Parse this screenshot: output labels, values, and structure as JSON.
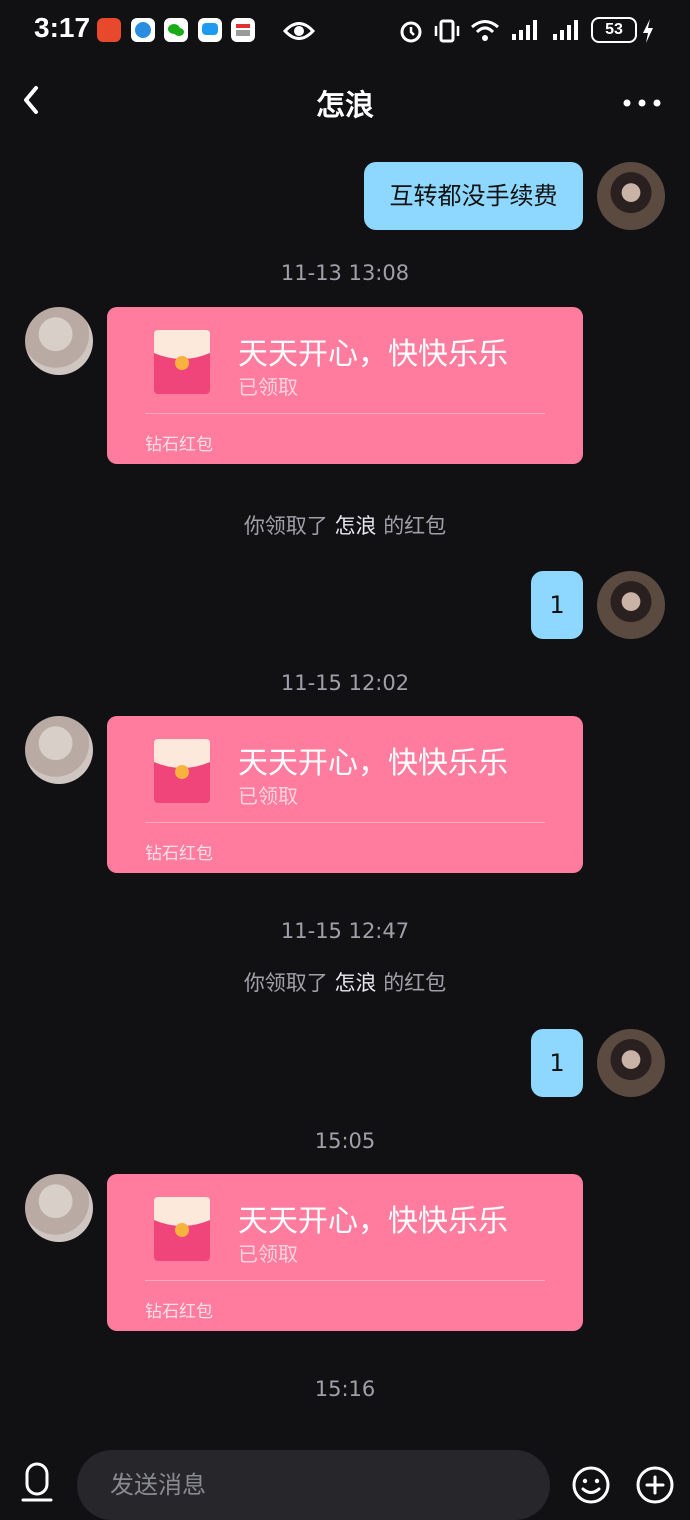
{
  "status_bar": {
    "time": "3:17",
    "battery": "53",
    "icons": [
      "notification-app-icon",
      "browser-app-icon",
      "wechat-icon",
      "message-app-icon",
      "news-app-icon",
      "eye-icon",
      "alarm-icon",
      "vibrate-icon",
      "wifi-icon",
      "signal-icon",
      "signal-icon",
      "battery-icon",
      "charging-icon"
    ]
  },
  "header": {
    "title": "怎浪",
    "back_icon": "chevron-left-icon",
    "more_icon": "more-horizontal-icon"
  },
  "messages": {
    "m1_text": "互转都没手续费",
    "t1": "11-13 13:08",
    "rp1_title": "天天开心，快快乐乐",
    "rp1_status": "已领取",
    "rp1_label": "钻石红包",
    "sys1_prefix": "你领取了",
    "sys1_name": "怎浪",
    "sys1_suffix": "的红包",
    "m2_text": "1",
    "t2": "11-15 12:02",
    "rp2_title": "天天开心，快快乐乐",
    "rp2_status": "已领取",
    "rp2_label": "钻石红包",
    "t3": "11-15 12:47",
    "sys2_prefix": "你领取了",
    "sys2_name": "怎浪",
    "sys2_suffix": "的红包",
    "m3_text": "1",
    "t4": "15:05",
    "rp3_title": "天天开心，快快乐乐",
    "rp3_status": "已领取",
    "rp3_label": "钻石红包",
    "t5": "15:16"
  },
  "composer": {
    "placeholder": "发送消息",
    "mic_icon": "microphone-icon",
    "emoji_icon": "emoji-icon",
    "plus_icon": "plus-icon"
  },
  "colors": {
    "background": "#111114",
    "my_bubble": "#8ed8ff",
    "red_packet": "#ff7c9f",
    "muted_text": "#a0a0a8"
  }
}
